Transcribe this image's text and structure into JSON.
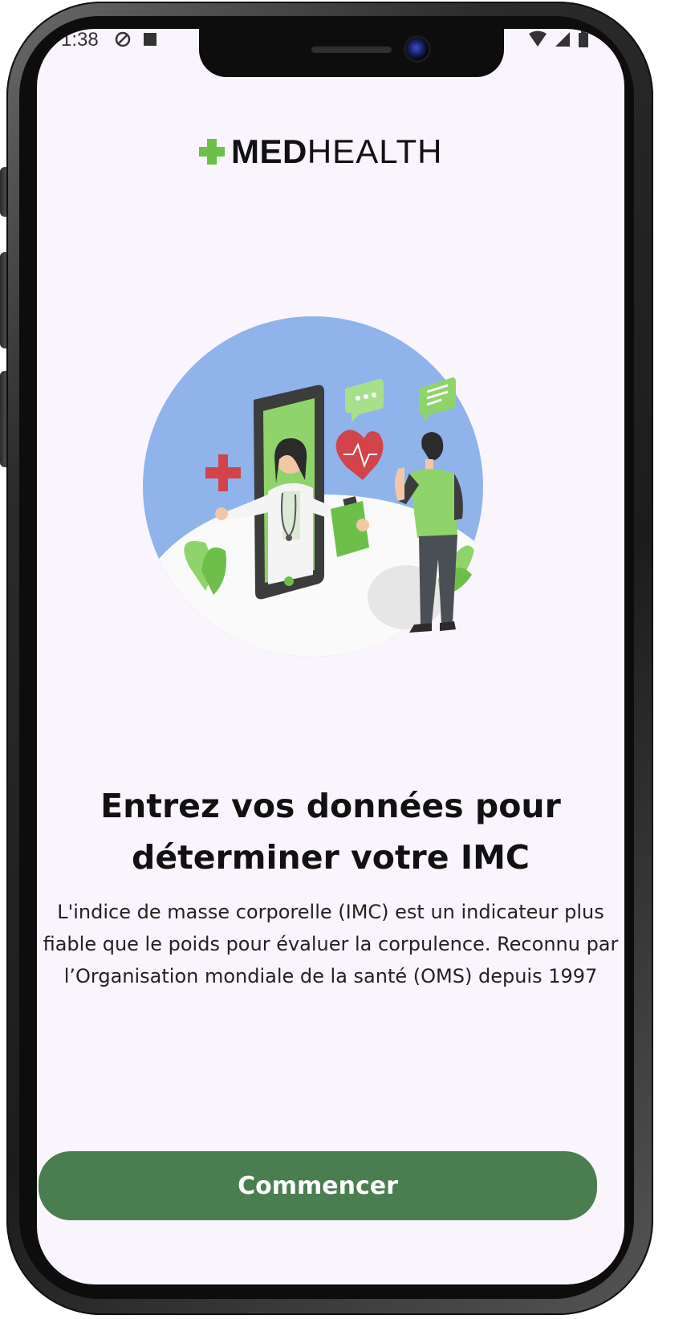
{
  "status_bar": {
    "time": "1:38",
    "left_icons": [
      "vpn-icon",
      "notification-icon"
    ],
    "right_icons": [
      "wifi-icon",
      "signal-icon",
      "battery-icon"
    ]
  },
  "logo": {
    "med": "MED",
    "health": "HEALTH",
    "accent_color": "#6cc04a"
  },
  "illustration": {
    "icon": "telemedicine-doctor-illustration"
  },
  "intro": {
    "title": "Entrez vos données pour déterminer votre IMC",
    "description": "L'indice de masse corporelle (IMC) est un indicateur plus fiable que le poids pour évaluer la corpulence. Reconnu par l’Organisation mondiale de la santé (OMS) depuis 1997"
  },
  "cta": {
    "label": "Commencer",
    "color": "#4a7d50"
  }
}
